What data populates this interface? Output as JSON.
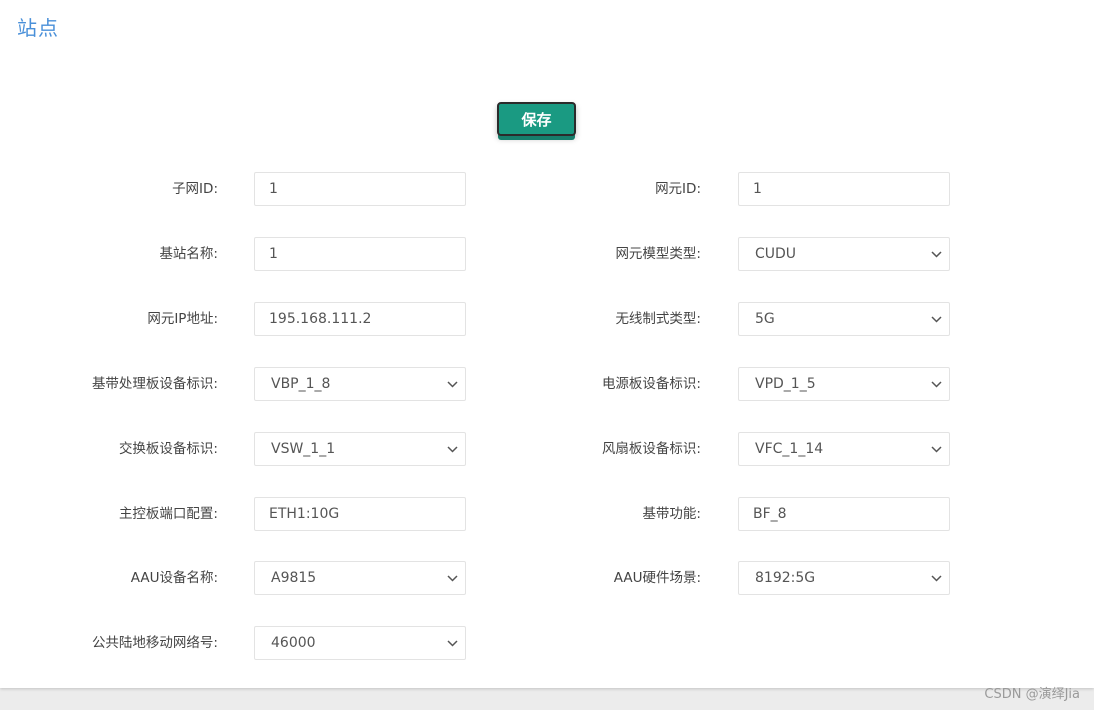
{
  "page": {
    "title": "站点"
  },
  "toolbar": {
    "save_label": "保存"
  },
  "fields": {
    "subnet_id": {
      "label": "子网ID:",
      "value": "1"
    },
    "ne_id": {
      "label": "网元ID:",
      "value": "1"
    },
    "station_name": {
      "label": "基站名称:",
      "value": "1"
    },
    "ne_model_type": {
      "label": "网元模型类型:",
      "value": "CUDU"
    },
    "ne_ip": {
      "label": "网元IP地址:",
      "value": "195.168.111.2"
    },
    "radio_mode_type": {
      "label": "无线制式类型:",
      "value": "5G"
    },
    "baseband_board_id": {
      "label": "基带处理板设备标识:",
      "value": "VBP_1_8"
    },
    "power_board_id": {
      "label": "电源板设备标识:",
      "value": "VPD_1_5"
    },
    "switch_board_id": {
      "label": "交换板设备标识:",
      "value": "VSW_1_1"
    },
    "fan_board_id": {
      "label": "风扇板设备标识:",
      "value": "VFC_1_14"
    },
    "main_ctrl_port": {
      "label": "主控板端口配置:",
      "value": "ETH1:10G"
    },
    "baseband_function": {
      "label": "基带功能:",
      "value": "BF_8"
    },
    "aau_name": {
      "label": "AAU设备名称:",
      "value": "A9815"
    },
    "aau_hw_scene": {
      "label": "AAU硬件场景:",
      "value": "8192:5G"
    },
    "plmn": {
      "label": "公共陆地移动网络号:",
      "value": "46000"
    }
  },
  "watermark": "CSDN @演绎Jia",
  "colors": {
    "title": "#4a90d9",
    "save_button": "#1a9a82",
    "background": "#ececec"
  }
}
